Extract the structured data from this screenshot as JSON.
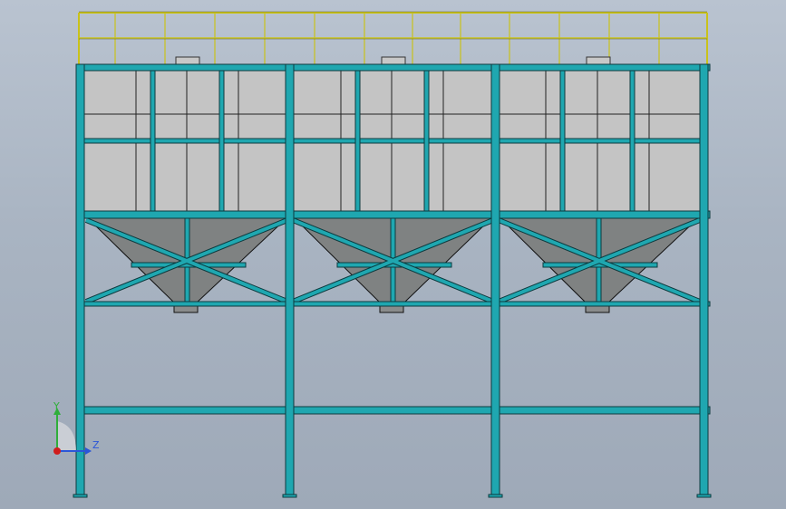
{
  "viewport": {
    "background_top": "#b9c3d0",
    "background_bottom": "#9ea9b8"
  },
  "model": {
    "steel_color": "#1fa7b0",
    "bin_panel_color": "#c4c4c4",
    "hopper_color": "#7f8282",
    "railing_color": "#c9c21a",
    "bay_count": 3,
    "hatch_count": 3
  },
  "triad": {
    "y_label": "Y",
    "z_label": "Z",
    "y_color": "#2fae3a",
    "z_color": "#2a56d8",
    "x_color": "#d01d1d"
  }
}
